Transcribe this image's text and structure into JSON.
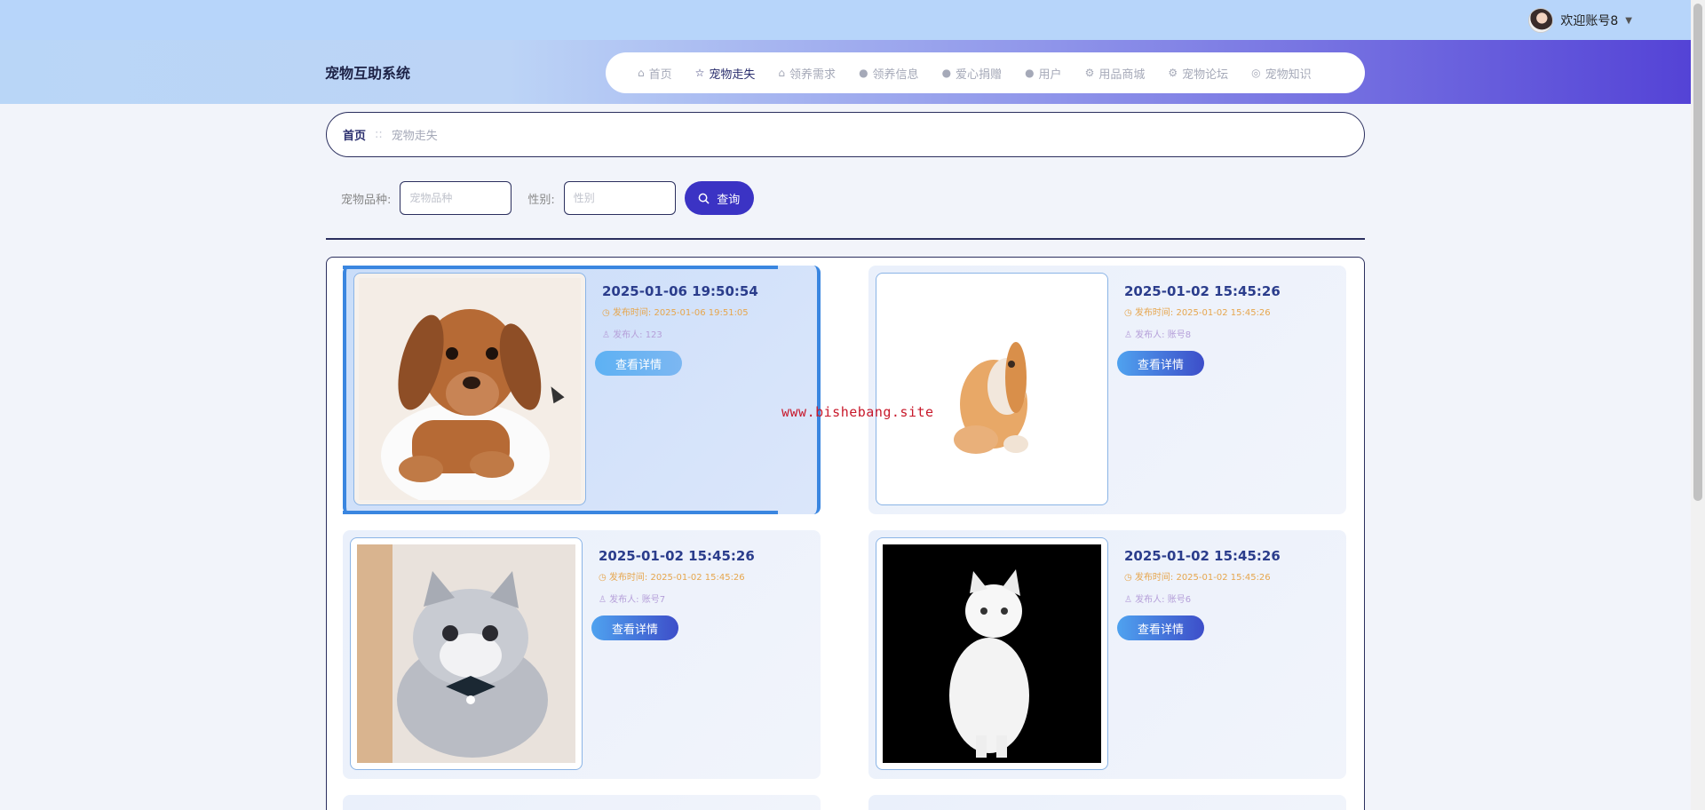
{
  "topbar": {
    "welcome": "欢迎账号8",
    "caret": "▼"
  },
  "header": {
    "title": "宠物互助系统"
  },
  "nav": [
    {
      "icon": "⌂",
      "label": "首页",
      "active": false
    },
    {
      "icon": "☆",
      "label": "宠物走失",
      "active": true
    },
    {
      "icon": "⌂",
      "label": "领养需求",
      "active": false
    },
    {
      "icon": "●",
      "label": "领养信息",
      "active": false
    },
    {
      "icon": "●",
      "label": "爱心捐赠",
      "active": false
    },
    {
      "icon": "●",
      "label": "用户",
      "active": false
    },
    {
      "icon": "⚙",
      "label": "用品商城",
      "active": false
    },
    {
      "icon": "⚙",
      "label": "宠物论坛",
      "active": false
    },
    {
      "icon": "◎",
      "label": "宠物知识",
      "active": false
    }
  ],
  "breadcrumb": {
    "home": "首页",
    "sep": "::",
    "current": "宠物走失"
  },
  "search": {
    "breed_label": "宠物品种:",
    "breed_placeholder": "宠物品种",
    "gender_label": "性别:",
    "gender_placeholder": "性别",
    "button": "查询"
  },
  "cards": [
    {
      "date": "2025-01-06 19:50:54",
      "time_text": "◷ 发布时间: 2025-01-06 19:51:05",
      "author_text": "♙ 发布人: 123",
      "button": "查看详情",
      "image": "dachshund-puppy"
    },
    {
      "date": "2025-01-02 15:45:26",
      "time_text": "◷ 发布时间: 2025-01-02 15:45:26",
      "author_text": "♙ 发布人: 账号8",
      "button": "查看详情",
      "image": "lop-rabbit"
    },
    {
      "date": "2025-01-02 15:45:26",
      "time_text": "◷ 发布时间: 2025-01-02 15:45:26",
      "author_text": "♙ 发布人: 账号7",
      "button": "查看详情",
      "image": "grey-kitten"
    },
    {
      "date": "2025-01-02 15:45:26",
      "time_text": "◷ 发布时间: 2025-01-02 15:45:26",
      "author_text": "♙ 发布人: 账号6",
      "button": "查看详情",
      "image": "white-persian-cat"
    }
  ],
  "watermark": "www.bishebang.site"
}
